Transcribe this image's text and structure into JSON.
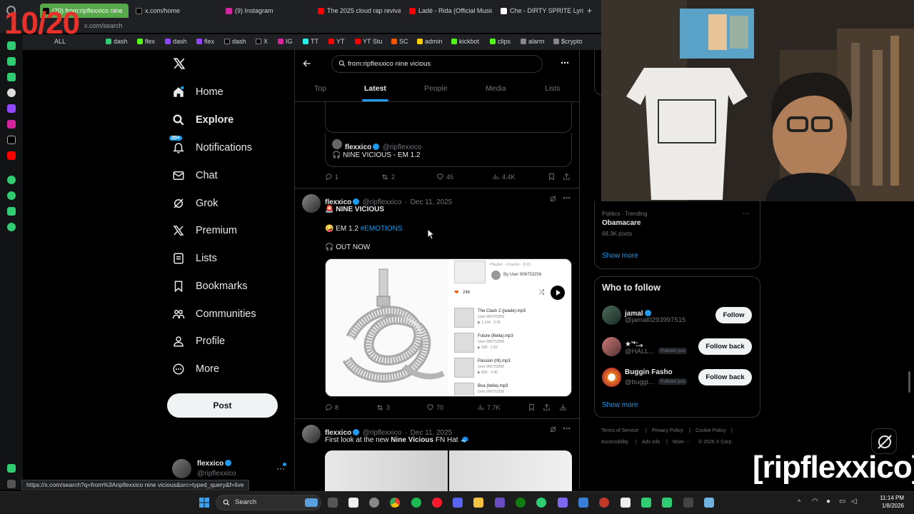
{
  "overlay": {
    "counter": "10/20",
    "streamer_name": "[ripflexxico]"
  },
  "browser": {
    "tabs": [
      {
        "label": "(20) from:ripflexxico nine",
        "active": true
      },
      {
        "label": "x.com/home"
      },
      {
        "label": "(9) Instagram"
      },
      {
        "label": "The 2025 cloud rap reviva"
      },
      {
        "label": "Ladé - Rida (Official Music"
      },
      {
        "label": "Che - DIRTY SPRITE Lyric"
      }
    ],
    "address": "x.com/search",
    "bookmarks": [
      "ALL",
      "dash",
      "flex",
      "dash",
      "flex",
      "dash",
      "X",
      "IG",
      "TT",
      "YT",
      "YT Stu",
      "SC",
      "admin",
      "kickbot",
      "clips",
      "alarm",
      "$crypto"
    ],
    "status_url": "https://x.com/search?q=from%3Aripflexxico nine vicious&src=typed_query&f=live"
  },
  "nav": {
    "items": [
      {
        "label": "Home",
        "icon": "home-icon"
      },
      {
        "label": "Explore",
        "icon": "search-icon"
      },
      {
        "label": "Notifications",
        "icon": "bell-icon",
        "badge": "20+"
      },
      {
        "label": "Chat",
        "icon": "mail-icon"
      },
      {
        "label": "Grok",
        "icon": "grok-icon"
      },
      {
        "label": "Premium",
        "icon": "x-logo-icon"
      },
      {
        "label": "Lists",
        "icon": "list-icon"
      },
      {
        "label": "Bookmarks",
        "icon": "bookmark-icon"
      },
      {
        "label": "Communities",
        "icon": "people-icon"
      },
      {
        "label": "Profile",
        "icon": "person-icon"
      },
      {
        "label": "More",
        "icon": "more-circle-icon"
      }
    ],
    "post_label": "Post",
    "account": {
      "name": "flexxico",
      "handle": "@ripflexxico"
    }
  },
  "search": {
    "query": "from:ripflexxico nine vicious",
    "tabs": [
      "Top",
      "Latest",
      "People",
      "Media",
      "Lists"
    ],
    "active_tab": "Latest"
  },
  "feed": {
    "quoted": {
      "name": "flexxico",
      "handle": "@ripflexxico",
      "text": "🎧 NINE VICIOUS - EM 1.2"
    },
    "post0_actions": {
      "replies": "1",
      "reposts": "2",
      "likes": "45",
      "views": "4.4K"
    },
    "post1": {
      "name": "flexxico",
      "handle": "@ripflexxico",
      "date": "Dec 11, 2025",
      "line1": "🚨 NINE VICIOUS",
      "line2_prefix": "🤪 EM 1.2 ",
      "hashtag": "#EMOTIONS",
      "line3": "🎧 OUT NOW",
      "playlist": {
        "header": "Playlist · 4 tracks · 9:15",
        "by": "By User 906753258",
        "likes": "248",
        "tracks": [
          {
            "title": "The Clash 2 (jwade).mp3",
            "user": "User 906753258",
            "stats": "▶ 1,144 · 2:35"
          },
          {
            "title": "Future (Bella).mp3",
            "user": "User 906753258",
            "stats": "▶ 935 · 1:52"
          },
          {
            "title": "Passion (r8).mp3",
            "user": "User 906753258",
            "stats": "▶ 824 · 2:40"
          },
          {
            "title": "Boa (bella).mp3",
            "user": "User 906753258",
            "stats": ""
          }
        ]
      },
      "actions": {
        "replies": "8",
        "reposts": "3",
        "likes": "70",
        "views": "7.7K"
      }
    },
    "post2": {
      "name": "flexxico",
      "handle": "@ripflexxico",
      "date": "Dec 11, 2025",
      "text_prefix": "First look at the new ",
      "text_bold": "Nine Vicious",
      "text_suffix": " FN Hat 🧢"
    }
  },
  "trending": {
    "category": "Politics · Trending",
    "topic": "Obamacare",
    "count": "68.3K posts",
    "show_more": "Show more"
  },
  "who_to_follow": {
    "title": "Who to follow",
    "users": [
      {
        "name": "jamal",
        "handle": "@jamal0293997515",
        "button": "Follow",
        "follows_you": ""
      },
      {
        "name": "★'*:.。",
        "handle": "@HALL...",
        "button": "Follow back",
        "follows_you": "Follows you"
      },
      {
        "name": "Buggin Fasho",
        "handle": "@buggi...",
        "button": "Follow back",
        "follows_you": "Follows you"
      }
    ],
    "show_more": "Show more"
  },
  "footer": {
    "links": [
      "Terms of Service",
      "|",
      "Privacy Policy",
      "|",
      "Cookie Policy",
      "|",
      "Accessibility",
      "|",
      "Ads info",
      "|",
      "More ···",
      "© 2026 X Corp."
    ]
  },
  "taskbar": {
    "search": "Search",
    "time": "11:14 PM",
    "date": "1/8/2026"
  },
  "colors": {
    "accent": "#1d9bf0",
    "background": "#000000",
    "border": "#2f3336",
    "muted": "#71767b",
    "like": "#f91880"
  }
}
